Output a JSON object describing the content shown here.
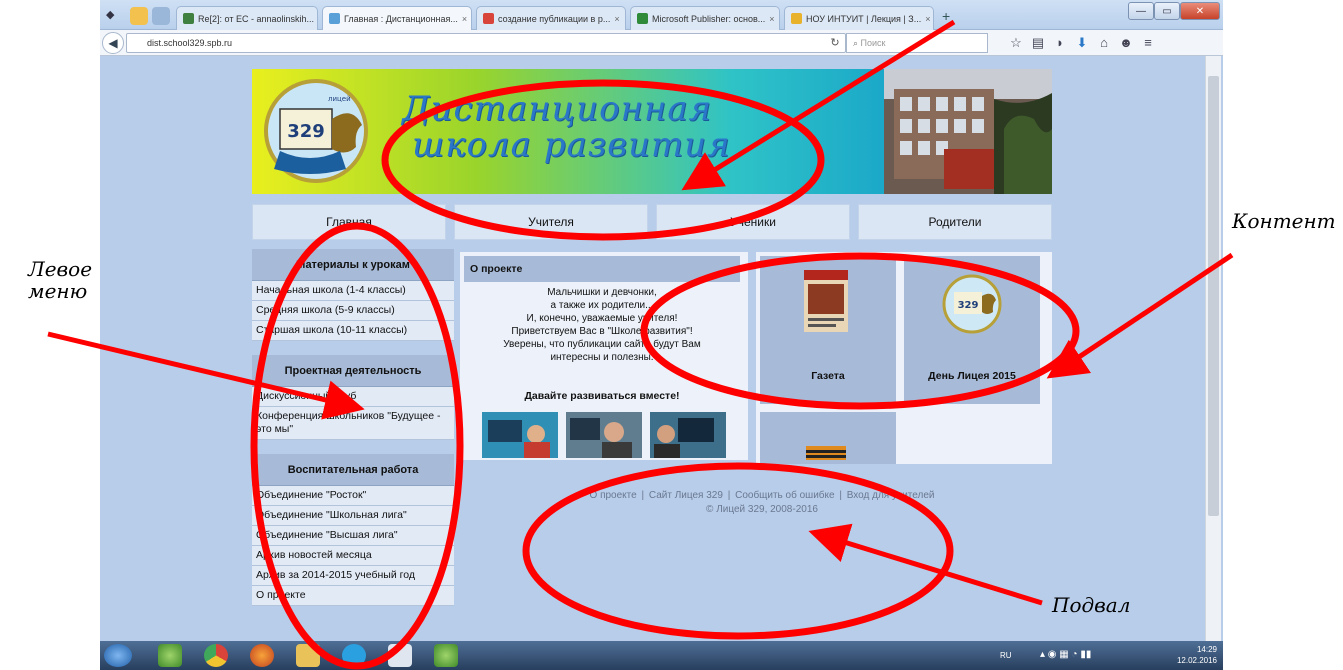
{
  "browser": {
    "tabs": [
      {
        "label": "Re[2]: от ЕС - annaolinskih...",
        "active": false
      },
      {
        "label": "Главная : Дистанционная...",
        "active": true
      },
      {
        "label": "создание публикации в р...",
        "active": false
      },
      {
        "label": "Microsoft Publisher: основ...",
        "active": false
      },
      {
        "label": "НОУ ИНТУИТ | Лекция | З...",
        "active": false
      }
    ],
    "new_tab": "+",
    "url": "dist.school329.spb.ru",
    "search_placeholder": "Поиск"
  },
  "site": {
    "logo_number": "329",
    "logo_text": "лицей",
    "banner_title_line1": "Дистанционная",
    "banner_title_line2": "школа развития",
    "topnav": [
      "Главная",
      "Учителя",
      "Ученики",
      "Родители"
    ],
    "left_menu": [
      {
        "heading": "Материалы к урокам",
        "items": [
          "Начальная школа (1-4 классы)",
          "Средняя школа (5-9 классы)",
          "Старшая школа (10-11 классы)"
        ]
      },
      {
        "heading": "Проектная деятельность",
        "items": [
          "Дискуссионный клуб",
          "Конференция школьников \"Будущее - это мы\""
        ]
      },
      {
        "heading": "Воспитательная работа",
        "items": [
          "Объединение \"Росток\"",
          "Объединение \"Школьная лига\"",
          "Объединение \"Высшая лига\"",
          "Архив новостей месяца",
          "Архив за 2014-2015 учебный год",
          "О проекте"
        ]
      }
    ],
    "about": {
      "heading": "О проекте",
      "lines": [
        "Мальчишки и девчонки,",
        "а также их родители...",
        "И, конечно, уважаемые учителя!",
        "Приветствуем Вас в \"Школе развития\"!",
        "Уверены, что публикации сайта будут Вам",
        "интересны и полезны."
      ],
      "cta": "Давайте развиваться вместе!"
    },
    "tiles": [
      {
        "title": "Газета"
      },
      {
        "title": "День Лицея 2015"
      },
      {
        "title": ""
      }
    ],
    "footer": {
      "links": [
        "О проекте",
        "Сайт Лицея 329",
        "Сообщить об ошибке",
        "Вход для учителей"
      ],
      "separator": "|",
      "copyright": "© Лицей 329, 2008-2016"
    }
  },
  "taskbar": {
    "lang": "RU",
    "time": "14:29",
    "date": "12.02.2016"
  },
  "annotations": {
    "left_menu": [
      "Левое",
      "меню"
    ],
    "content": "Контент",
    "footer": "Подвал",
    "color": "#ff0000"
  }
}
